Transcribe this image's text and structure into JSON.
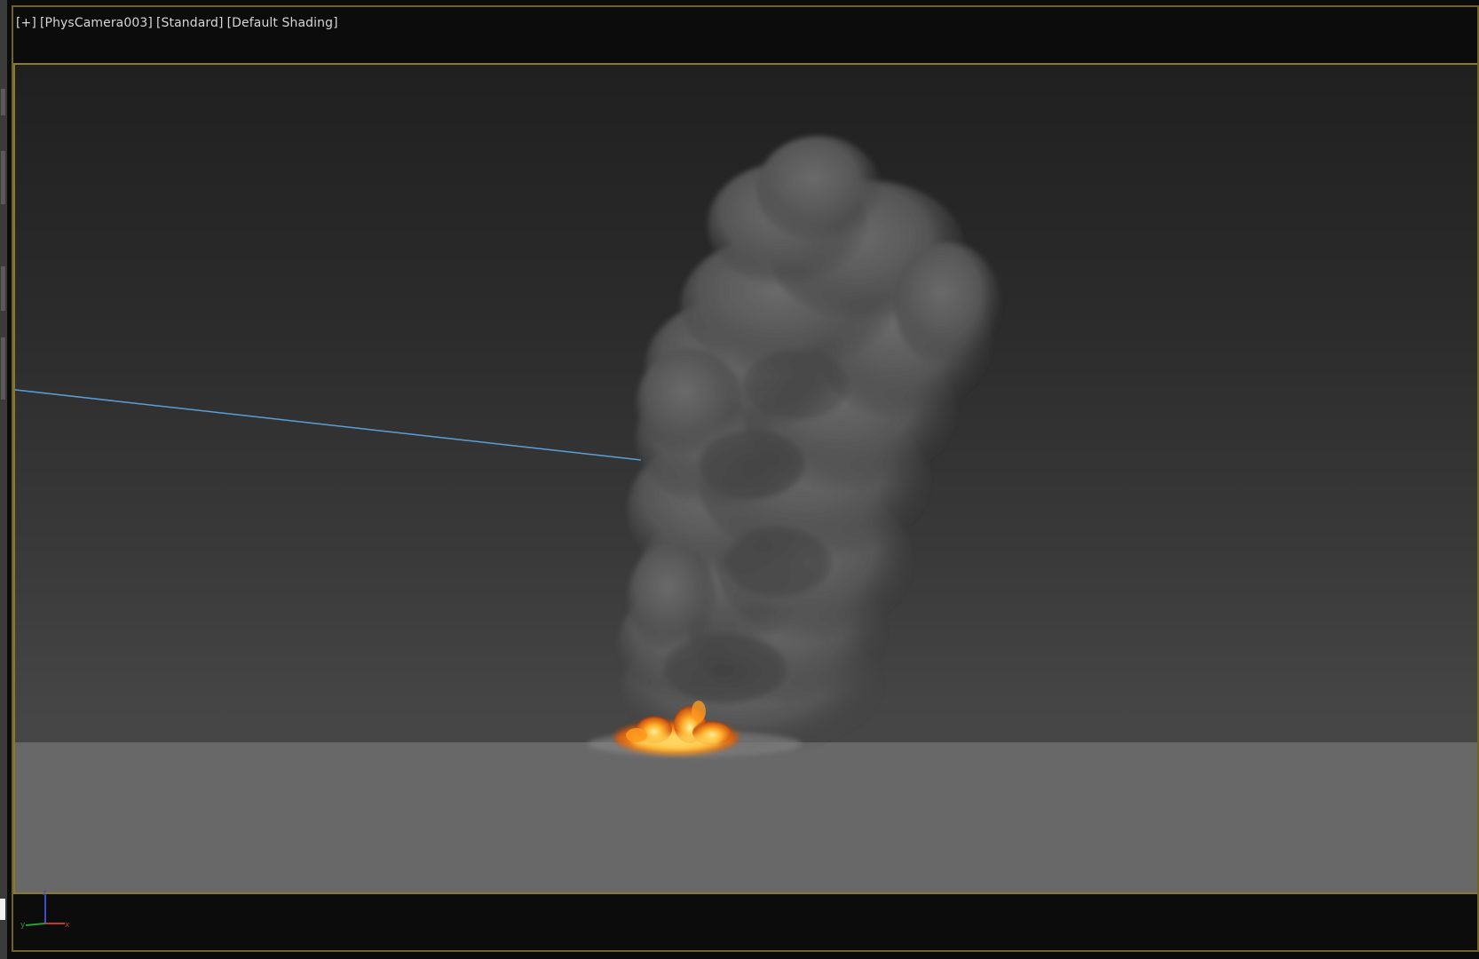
{
  "viewport": {
    "label": {
      "plus": "[+]",
      "camera": "[PhysCamera003]",
      "mode": "[Standard]",
      "shading": "[Default Shading]"
    },
    "axis_gizmo": {
      "z_label": "z",
      "y_label": "y",
      "x_label": "x",
      "colors": {
        "x": "#c0392b",
        "y": "#2e9a3a",
        "z": "#3a4fc8"
      }
    },
    "scene": {
      "smoke_color": "#555555",
      "fire_color": "#ff9a1f",
      "target_line_color": "#5a9fd8",
      "ground_color": "#686868"
    }
  },
  "colors": {
    "frame_border": "#6f6424",
    "safe_frame_border": "#8a7a2c",
    "label_text": "#d6d6d6"
  }
}
